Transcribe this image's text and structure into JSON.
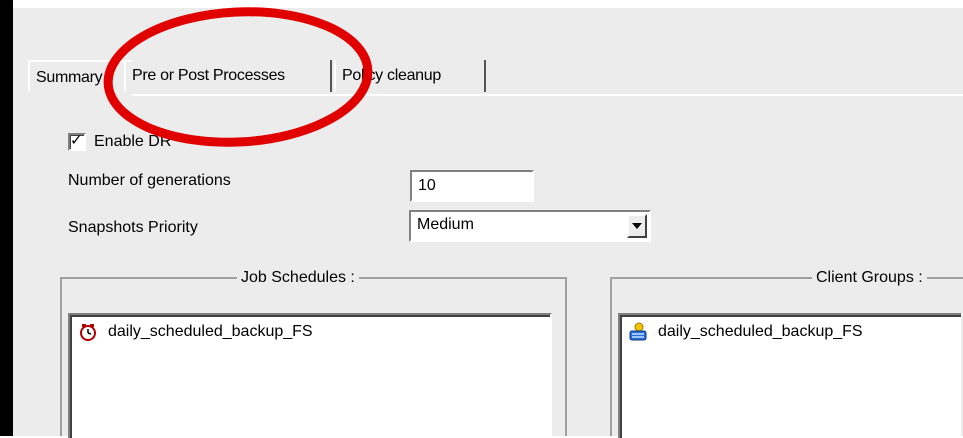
{
  "tabs": [
    {
      "label": "Summary"
    },
    {
      "label": "Pre or Post Processes"
    },
    {
      "label": "Policy cleanup"
    }
  ],
  "checkbox": {
    "label": "Enable DR",
    "checked": true,
    "mark": "✓"
  },
  "generations": {
    "label": "Number of generations",
    "value": "10"
  },
  "priority": {
    "label": "Snapshots Priority",
    "value": "Medium"
  },
  "job_schedules": {
    "title": "Job Schedules :",
    "items": [
      {
        "label": "daily_scheduled_backup_FS",
        "icon": "clock-icon"
      }
    ]
  },
  "client_groups": {
    "title": "Client Groups :",
    "items": [
      {
        "label": "daily_scheduled_backup_FS",
        "icon": "client-group-icon"
      }
    ]
  },
  "colors": {
    "annotation": "#e00000",
    "panel": "#ececec"
  }
}
